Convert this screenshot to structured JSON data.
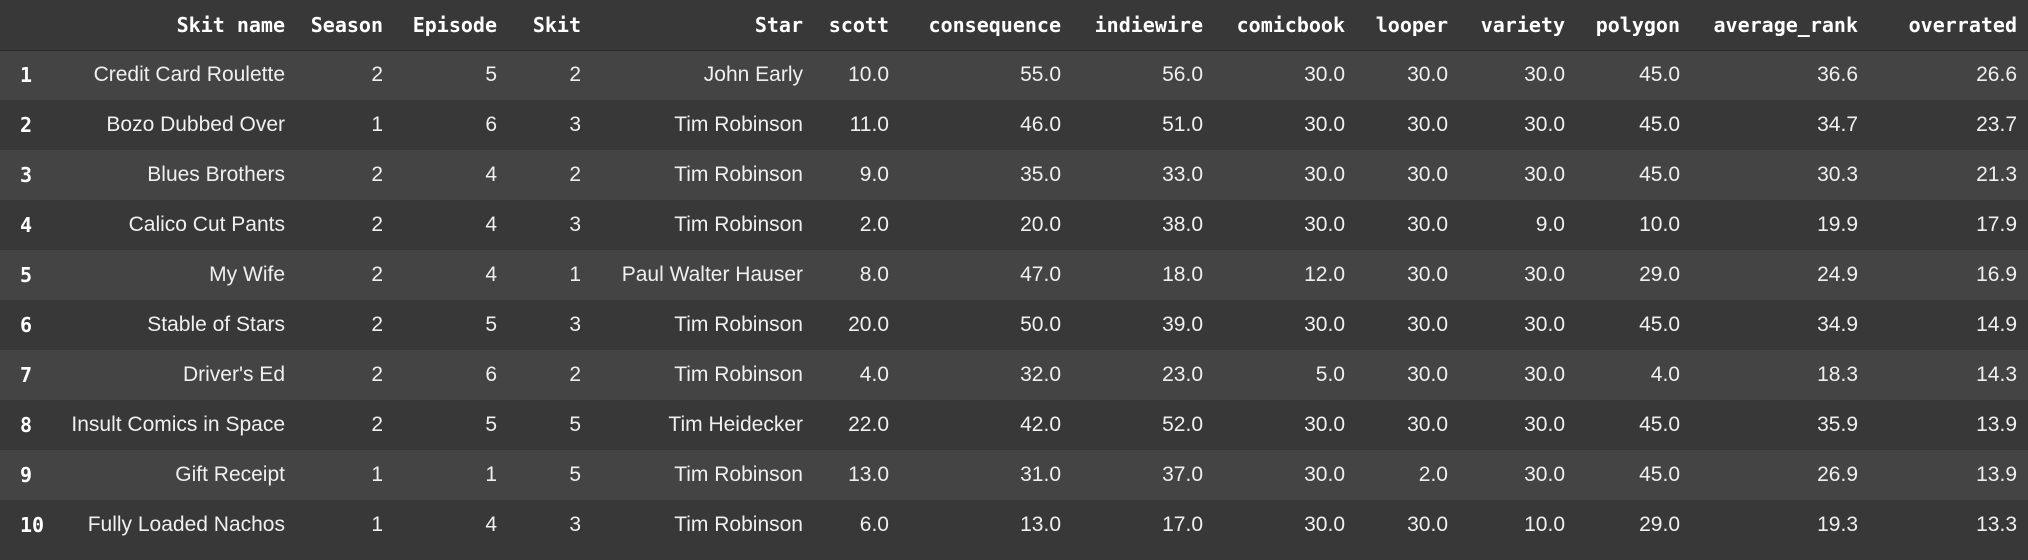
{
  "table": {
    "columns": [
      "",
      "Skit name",
      "Season",
      "Episode",
      "Skit",
      "Star",
      "scott",
      "consequence",
      "indiewire",
      "comicbook",
      "looper",
      "variety",
      "polygon",
      "average_rank",
      "overrated"
    ],
    "rows": [
      [
        "1",
        "Credit Card Roulette",
        "2",
        "5",
        "2",
        "John Early",
        "10.0",
        "55.0",
        "56.0",
        "30.0",
        "30.0",
        "30.0",
        "45.0",
        "36.6",
        "26.6"
      ],
      [
        "2",
        "Bozo Dubbed Over",
        "1",
        "6",
        "3",
        "Tim Robinson",
        "11.0",
        "46.0",
        "51.0",
        "30.0",
        "30.0",
        "30.0",
        "45.0",
        "34.7",
        "23.7"
      ],
      [
        "3",
        "Blues Brothers",
        "2",
        "4",
        "2",
        "Tim Robinson",
        "9.0",
        "35.0",
        "33.0",
        "30.0",
        "30.0",
        "30.0",
        "45.0",
        "30.3",
        "21.3"
      ],
      [
        "4",
        "Calico Cut Pants",
        "2",
        "4",
        "3",
        "Tim Robinson",
        "2.0",
        "20.0",
        "38.0",
        "30.0",
        "30.0",
        "9.0",
        "10.0",
        "19.9",
        "17.9"
      ],
      [
        "5",
        "My Wife",
        "2",
        "4",
        "1",
        "Paul Walter Hauser",
        "8.0",
        "47.0",
        "18.0",
        "12.0",
        "30.0",
        "30.0",
        "29.0",
        "24.9",
        "16.9"
      ],
      [
        "6",
        "Stable of Stars",
        "2",
        "5",
        "3",
        "Tim Robinson",
        "20.0",
        "50.0",
        "39.0",
        "30.0",
        "30.0",
        "30.0",
        "45.0",
        "34.9",
        "14.9"
      ],
      [
        "7",
        "Driver's Ed",
        "2",
        "6",
        "2",
        "Tim Robinson",
        "4.0",
        "32.0",
        "23.0",
        "5.0",
        "30.0",
        "30.0",
        "4.0",
        "18.3",
        "14.3"
      ],
      [
        "8",
        "Insult Comics in Space",
        "2",
        "5",
        "5",
        "Tim Heidecker",
        "22.0",
        "42.0",
        "52.0",
        "30.0",
        "30.0",
        "30.0",
        "45.0",
        "35.9",
        "13.9"
      ],
      [
        "9",
        "Gift Receipt",
        "1",
        "1",
        "5",
        "Tim Robinson",
        "13.0",
        "31.0",
        "37.0",
        "30.0",
        "2.0",
        "30.0",
        "45.0",
        "26.9",
        "13.9"
      ],
      [
        "10",
        "Fully Loaded Nachos",
        "1",
        "4",
        "3",
        "Tim Robinson",
        "6.0",
        "13.0",
        "17.0",
        "30.0",
        "30.0",
        "10.0",
        "29.0",
        "19.3",
        "13.3"
      ]
    ]
  },
  "theme": {
    "background": "#383838",
    "row_alt": "#444444",
    "text": "#f0f0f0"
  }
}
